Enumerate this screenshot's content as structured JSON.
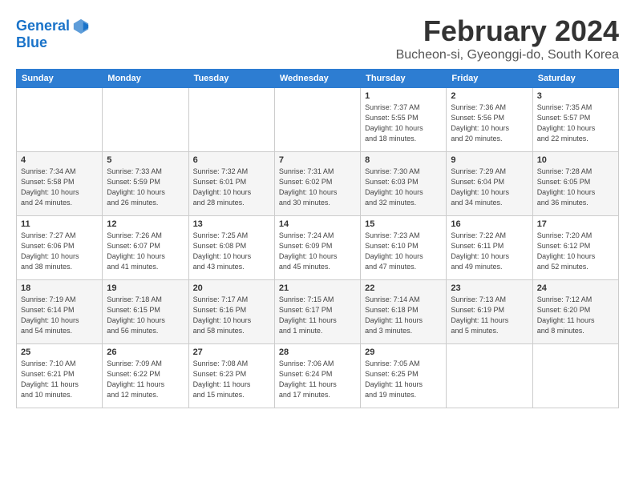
{
  "logo": {
    "line1": "General",
    "line2": "Blue"
  },
  "title": "February 2024",
  "subtitle": "Bucheon-si, Gyeonggi-do, South Korea",
  "weekdays": [
    "Sunday",
    "Monday",
    "Tuesday",
    "Wednesday",
    "Thursday",
    "Friday",
    "Saturday"
  ],
  "weeks": [
    [
      {
        "day": "",
        "info": ""
      },
      {
        "day": "",
        "info": ""
      },
      {
        "day": "",
        "info": ""
      },
      {
        "day": "",
        "info": ""
      },
      {
        "day": "1",
        "info": "Sunrise: 7:37 AM\nSunset: 5:55 PM\nDaylight: 10 hours\nand 18 minutes."
      },
      {
        "day": "2",
        "info": "Sunrise: 7:36 AM\nSunset: 5:56 PM\nDaylight: 10 hours\nand 20 minutes."
      },
      {
        "day": "3",
        "info": "Sunrise: 7:35 AM\nSunset: 5:57 PM\nDaylight: 10 hours\nand 22 minutes."
      }
    ],
    [
      {
        "day": "4",
        "info": "Sunrise: 7:34 AM\nSunset: 5:58 PM\nDaylight: 10 hours\nand 24 minutes."
      },
      {
        "day": "5",
        "info": "Sunrise: 7:33 AM\nSunset: 5:59 PM\nDaylight: 10 hours\nand 26 minutes."
      },
      {
        "day": "6",
        "info": "Sunrise: 7:32 AM\nSunset: 6:01 PM\nDaylight: 10 hours\nand 28 minutes."
      },
      {
        "day": "7",
        "info": "Sunrise: 7:31 AM\nSunset: 6:02 PM\nDaylight: 10 hours\nand 30 minutes."
      },
      {
        "day": "8",
        "info": "Sunrise: 7:30 AM\nSunset: 6:03 PM\nDaylight: 10 hours\nand 32 minutes."
      },
      {
        "day": "9",
        "info": "Sunrise: 7:29 AM\nSunset: 6:04 PM\nDaylight: 10 hours\nand 34 minutes."
      },
      {
        "day": "10",
        "info": "Sunrise: 7:28 AM\nSunset: 6:05 PM\nDaylight: 10 hours\nand 36 minutes."
      }
    ],
    [
      {
        "day": "11",
        "info": "Sunrise: 7:27 AM\nSunset: 6:06 PM\nDaylight: 10 hours\nand 38 minutes."
      },
      {
        "day": "12",
        "info": "Sunrise: 7:26 AM\nSunset: 6:07 PM\nDaylight: 10 hours\nand 41 minutes."
      },
      {
        "day": "13",
        "info": "Sunrise: 7:25 AM\nSunset: 6:08 PM\nDaylight: 10 hours\nand 43 minutes."
      },
      {
        "day": "14",
        "info": "Sunrise: 7:24 AM\nSunset: 6:09 PM\nDaylight: 10 hours\nand 45 minutes."
      },
      {
        "day": "15",
        "info": "Sunrise: 7:23 AM\nSunset: 6:10 PM\nDaylight: 10 hours\nand 47 minutes."
      },
      {
        "day": "16",
        "info": "Sunrise: 7:22 AM\nSunset: 6:11 PM\nDaylight: 10 hours\nand 49 minutes."
      },
      {
        "day": "17",
        "info": "Sunrise: 7:20 AM\nSunset: 6:12 PM\nDaylight: 10 hours\nand 52 minutes."
      }
    ],
    [
      {
        "day": "18",
        "info": "Sunrise: 7:19 AM\nSunset: 6:14 PM\nDaylight: 10 hours\nand 54 minutes."
      },
      {
        "day": "19",
        "info": "Sunrise: 7:18 AM\nSunset: 6:15 PM\nDaylight: 10 hours\nand 56 minutes."
      },
      {
        "day": "20",
        "info": "Sunrise: 7:17 AM\nSunset: 6:16 PM\nDaylight: 10 hours\nand 58 minutes."
      },
      {
        "day": "21",
        "info": "Sunrise: 7:15 AM\nSunset: 6:17 PM\nDaylight: 11 hours\nand 1 minute."
      },
      {
        "day": "22",
        "info": "Sunrise: 7:14 AM\nSunset: 6:18 PM\nDaylight: 11 hours\nand 3 minutes."
      },
      {
        "day": "23",
        "info": "Sunrise: 7:13 AM\nSunset: 6:19 PM\nDaylight: 11 hours\nand 5 minutes."
      },
      {
        "day": "24",
        "info": "Sunrise: 7:12 AM\nSunset: 6:20 PM\nDaylight: 11 hours\nand 8 minutes."
      }
    ],
    [
      {
        "day": "25",
        "info": "Sunrise: 7:10 AM\nSunset: 6:21 PM\nDaylight: 11 hours\nand 10 minutes."
      },
      {
        "day": "26",
        "info": "Sunrise: 7:09 AM\nSunset: 6:22 PM\nDaylight: 11 hours\nand 12 minutes."
      },
      {
        "day": "27",
        "info": "Sunrise: 7:08 AM\nSunset: 6:23 PM\nDaylight: 11 hours\nand 15 minutes."
      },
      {
        "day": "28",
        "info": "Sunrise: 7:06 AM\nSunset: 6:24 PM\nDaylight: 11 hours\nand 17 minutes."
      },
      {
        "day": "29",
        "info": "Sunrise: 7:05 AM\nSunset: 6:25 PM\nDaylight: 11 hours\nand 19 minutes."
      },
      {
        "day": "",
        "info": ""
      },
      {
        "day": "",
        "info": ""
      }
    ]
  ]
}
